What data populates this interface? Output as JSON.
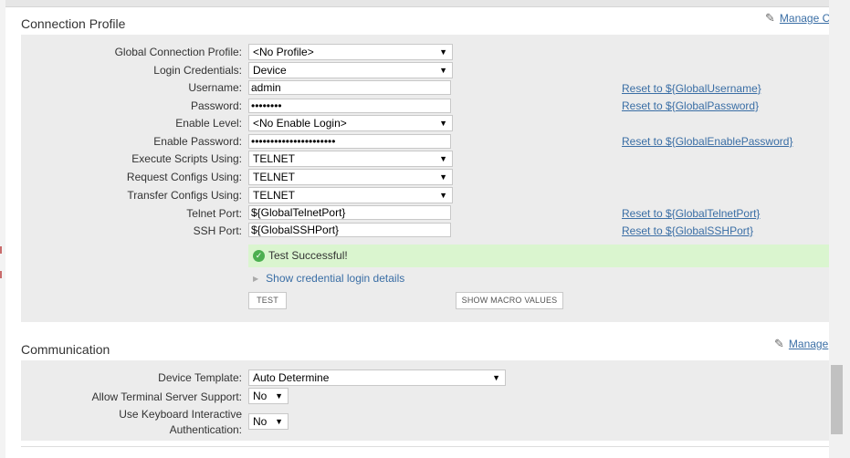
{
  "connection_profile": {
    "title": "Connection Profile",
    "manage_label": "Manage Co",
    "fields": {
      "global_profile": {
        "label": "Global Connection Profile:",
        "value": "<No Profile>"
      },
      "login_credentials": {
        "label": "Login Credentials:",
        "value": "Device"
      },
      "username": {
        "label": "Username:",
        "value": "admin"
      },
      "password": {
        "label": "Password:",
        "value": "••••••••"
      },
      "enable_level": {
        "label": "Enable Level:",
        "value": "<No Enable Login>"
      },
      "enable_password": {
        "label": "Enable Password:",
        "value": "••••••••••••••••••••••"
      },
      "execute_scripts": {
        "label": "Execute Scripts Using:",
        "value": "TELNET"
      },
      "request_configs": {
        "label": "Request Configs Using:",
        "value": "TELNET"
      },
      "transfer_configs": {
        "label": "Transfer Configs Using:",
        "value": "TELNET"
      },
      "telnet_port": {
        "label": "Telnet Port:",
        "value": "${GlobalTelnetPort}"
      },
      "ssh_port": {
        "label": "SSH Port:",
        "value": "${GlobalSSHPort}"
      }
    },
    "reset_links": {
      "username": "Reset to ${GlobalUsername}",
      "password": "Reset to ${GlobalPassword}",
      "enable_password": "Reset to ${GlobalEnablePassword}",
      "telnet_port": "Reset to ${GlobalTelnetPort}",
      "ssh_port": "Reset to ${GlobalSSHPort}"
    },
    "status_message": "Test Successful!",
    "details_toggle": "Show credential login details",
    "test_button": "TEST",
    "macro_button": "SHOW MACRO VALUES"
  },
  "communication": {
    "title": "Communication",
    "manage_label": "Manage",
    "fields": {
      "device_template": {
        "label": "Device Template:",
        "value": "Auto Determine"
      },
      "terminal_server": {
        "label": "Allow Terminal Server Support:",
        "value": "No"
      },
      "keyboard_auth_line1": "Use Keyboard Interactive",
      "keyboard_auth_line2": "Authentication:",
      "keyboard_auth_value": "No"
    }
  },
  "icons": {
    "caret": "▼",
    "pencil": "✎",
    "check": "✓",
    "expand_triangle": "▶"
  },
  "colors": {
    "panel_bg": "#ececec",
    "link": "#3a6ea5",
    "success_bg": "#daf5cf",
    "success_icon": "#4caf50"
  }
}
